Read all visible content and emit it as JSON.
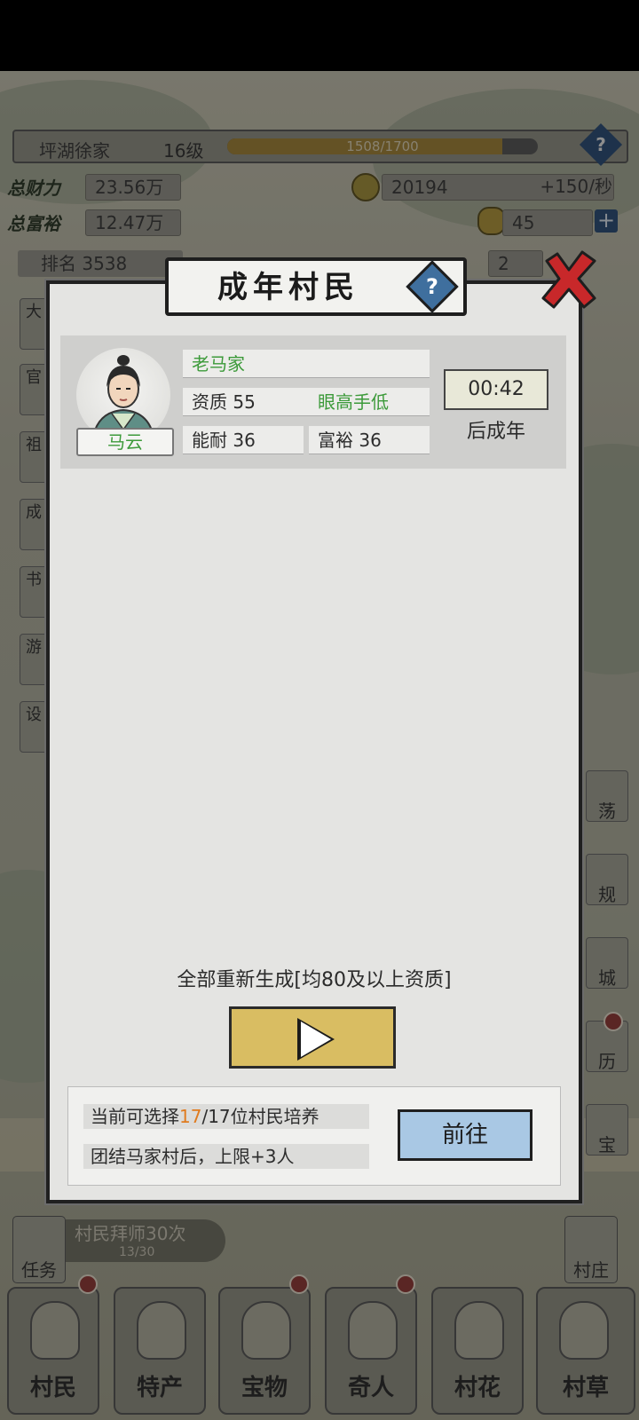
{
  "header": {
    "village_name": "坪湖徐家",
    "level": "16级",
    "exp_text": "1508/1700",
    "exp_fraction": 0.887
  },
  "stats": {
    "total_wealth_label": "总财力",
    "total_wealth_value": "23.56万",
    "total_rich_label": "总富裕",
    "total_rich_value": "12.47万",
    "coins_value": "20194",
    "coins_rate": "+150/秒",
    "ingots_value": "45",
    "rank_text": "排名 3538",
    "other_value": "2"
  },
  "side_left": [
    "大",
    "官",
    "祖",
    "成",
    "书",
    "游",
    "设"
  ],
  "side_right": [
    "荡",
    "规",
    "城",
    "历",
    "宝"
  ],
  "task": {
    "label": "任务",
    "banner": "村民拜师30次",
    "banner_sub": "13/30"
  },
  "village_button": "村庄",
  "bottom_nav": [
    {
      "label": "村民"
    },
    {
      "label": "特产"
    },
    {
      "label": "宝物"
    },
    {
      "label": "奇人"
    },
    {
      "label": "村花"
    },
    {
      "label": "村草"
    }
  ],
  "dialog": {
    "title": "成年村民",
    "help_glyph": "?",
    "villager": {
      "family": "老马家",
      "name": "马云",
      "aptitude": "资质 55",
      "trait": "眼高手低",
      "ability": "能耐 36",
      "wealth": "富裕 36",
      "timer": "00:42",
      "timer_label": "后成年"
    },
    "regen_label": "全部重新生成[均80及以上资质]",
    "footer": {
      "line1_prefix": "当前可选择",
      "line1_highlight": "17",
      "line1_suffix": "/17位村民培养",
      "line2": "团结马家村后，上限+3人",
      "goto_label": "前往"
    }
  },
  "colors": {
    "accent_green": "#3c9a3a",
    "accent_orange": "#e07b1e",
    "play_button": "#d9bd62",
    "goto_button": "#a9c8e4",
    "close_red": "#c8282a"
  }
}
